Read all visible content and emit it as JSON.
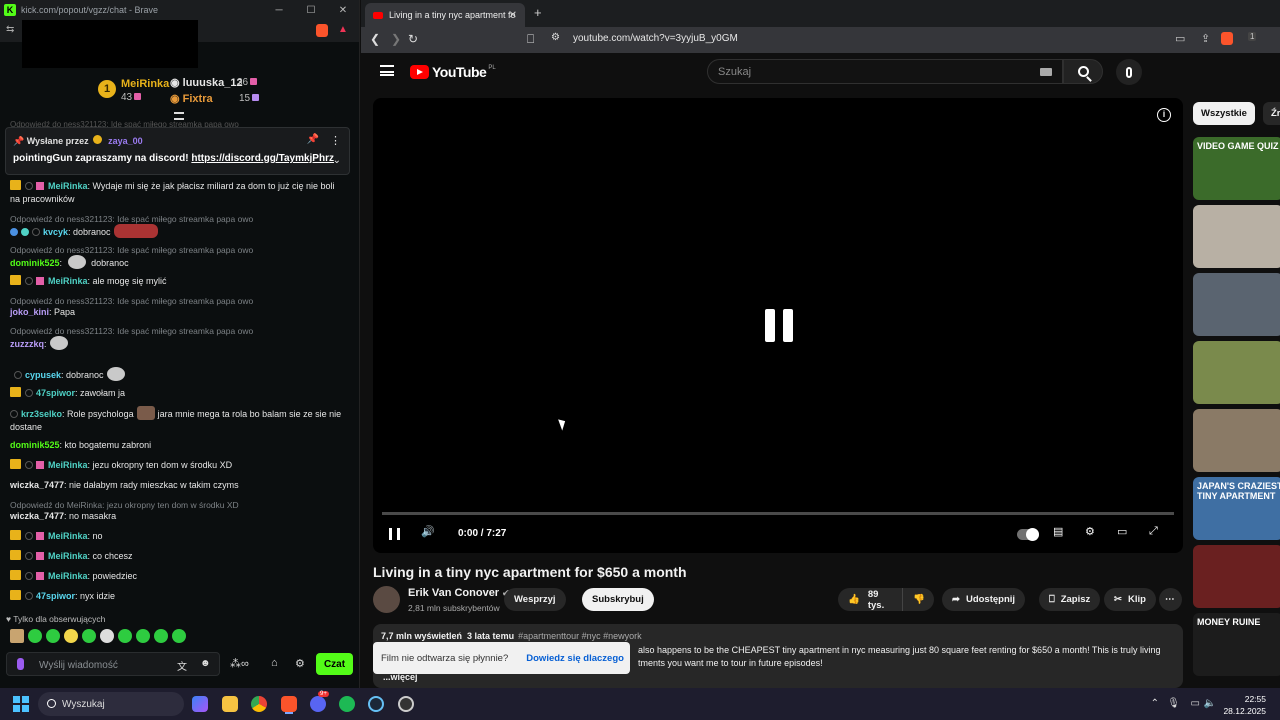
{
  "chat_window": {
    "title": "kick.com/popout/vgzz/chat - Brave",
    "leaderboard": [
      {
        "rank": "1",
        "name": "MeiRinka",
        "count": "43"
      },
      {
        "name": "luuuska_12",
        "count": "36"
      },
      {
        "name": "Fixtra",
        "count": "15"
      }
    ],
    "pinned": {
      "sent_by_label": "Wysłane przez",
      "sender": "zaya_00",
      "message_prefix": "pointingGun zapraszamy na discord! ",
      "link": "https://discord.gg/TaymkjPhrz"
    },
    "top_faded_reply": "Odpowiedź do ness321123: Ide spać miłego streamka papa owo",
    "messages": [
      {
        "user": "MeiRinka",
        "text": ": Wydaje mi się że jak płacisz miliard za dom to już cię nie boli na pracowników"
      },
      {
        "reply": "Odpowiedź do ness321123: Ide spać miłego streamka papa owo",
        "user": "kvcyk",
        "text": ": dobranoc"
      },
      {
        "reply": "Odpowiedź do ness321123: Ide spać miłego streamka papa owo",
        "user": "dominik525",
        "text": "dobranoc"
      },
      {
        "user": "MeiRinka",
        "text": ": ale mogę się mylić"
      },
      {
        "reply": "Odpowiedź do ness321123: Ide spać miłego streamka papa owo",
        "user": "joko_kini",
        "text": ": Papa"
      },
      {
        "reply": "Odpowiedź do ness321123: Ide spać miłego streamka papa owo",
        "user": "zuzzzkq",
        "text": ":"
      },
      {
        "user": "cypusek",
        "text": ": dobranoc"
      },
      {
        "user": "47spiwor",
        "text": ": zawołam ja"
      },
      {
        "user": "krz3selko",
        "text_a": ": Role psychologa",
        "text_b": "jara mnie mega ta rola bo balam sie ze sie nie dostane"
      },
      {
        "user": "dominik525",
        "text": ": kto bogatemu zabroni"
      },
      {
        "user": "MeiRinka",
        "text": ": jezu okropny ten dom w środku XD"
      },
      {
        "user": "wiczka_7477",
        "text": ": nie dałabym rady mieszkac w takim czyms"
      },
      {
        "reply": "Odpowiedź do MeiRinka: jezu okropny ten dom w środku XD",
        "user": "wiczka_7477",
        "text": ": no masakra"
      },
      {
        "user": "MeiRinka",
        "text": ": no"
      },
      {
        "user": "MeiRinka",
        "text": ": co chcesz"
      },
      {
        "user": "MeiRinka",
        "text": ": powiedziec"
      },
      {
        "user": "47spiwor",
        "text": ": nyx idzie"
      }
    ],
    "followers_only": "Tylko dla obserwujących",
    "input_placeholder": "Wyślij wiadomość",
    "send_label": "Czat",
    "kick_logo": "K"
  },
  "browser": {
    "tab_title": "Living in a tiny nyc apartment fo",
    "url": "youtube.com/watch?v=3yyjuB_y0GM",
    "extension_badge": "1"
  },
  "youtube": {
    "logo_text": "YouTube",
    "logo_country": "PL",
    "search_placeholder": "Szukaj",
    "video": {
      "time": "0:00 / 7:27",
      "progress": 0.0,
      "title": "Living in a tiny nyc apartment for $650 a month",
      "channel": "Erik Van Conover",
      "subscribers": "2,81 mln subskrybentów",
      "support_label": "Wesprzyj",
      "subscribe_label": "Subskrybuj",
      "likes": "89 tys.",
      "share_label": "Udostępnij",
      "save_label": "Zapisz",
      "clip_label": "Klip",
      "views": "7,7 mln wyświetleń",
      "age": "3 lata temu",
      "tags": "#apartmenttour #nyc #newyork",
      "desc_line1": "also happens to be the CHEAPEST tiny apartment in nyc measuring just 80 square feet renting for $650 a month! This is truly living",
      "desc_line2": "tments you want me to tour in future episodes!",
      "more_label": "...więcej"
    },
    "toast": {
      "text": "Film nie odtwarza się płynnie?",
      "action": "Dowiedz się dlaczego"
    },
    "chips": [
      "Wszystkie",
      "Źró"
    ],
    "thumbnails": [
      {
        "label": "VIDEO GAME QUIZ",
        "color": "#3b6b2a"
      },
      {
        "label": "",
        "color": "#b8b0a4"
      },
      {
        "label": "",
        "color": "#5a6470"
      },
      {
        "label": "",
        "color": "#7a8a4c"
      },
      {
        "label": "",
        "color": "#8a7a66"
      },
      {
        "label": "JAPAN'S CRAZIEST TINY APARTMENT",
        "color": "#3f6fa3"
      },
      {
        "label": "",
        "color": "#6a2020"
      },
      {
        "label": "MONEY RUINE",
        "color": "#1c1c1c"
      }
    ]
  },
  "taskbar": {
    "search_label": "Wyszukaj",
    "time": "22:55",
    "date": "28.12.2025",
    "discord_badge": "9+"
  }
}
